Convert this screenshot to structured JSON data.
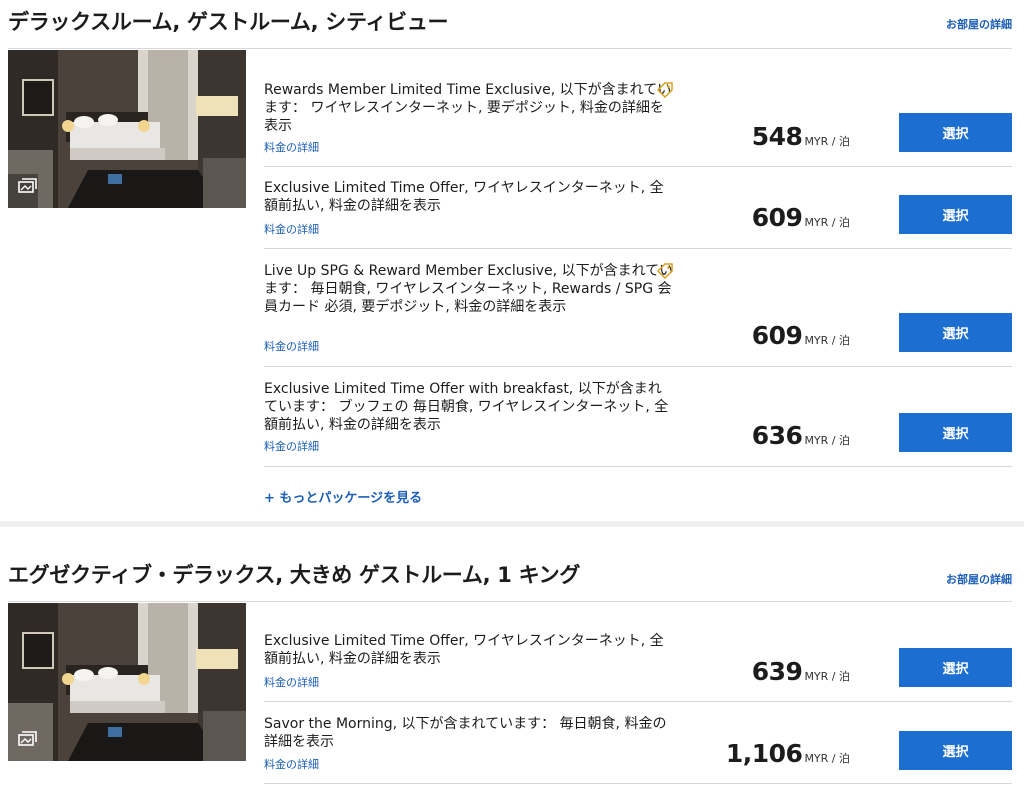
{
  "rooms": [
    {
      "title": "デラックスルーム, ゲストルーム, シティビュー",
      "detail_link": "お部屋の詳細",
      "more_packages": "+ もっとパッケージを見る",
      "rates": [
        {
          "name": "Rewards Member Limited Time Exclusive, 以下が含まれています： ワイヤレスインターネット, 要デポジット, 料金の詳細を表示",
          "detail": "料金の詳細",
          "price": "548",
          "unit": "MYR / 泊",
          "button": "選択",
          "tag": true
        },
        {
          "name": "Exclusive Limited Time Offer, ワイヤレスインターネット, 全額前払い, 料金の詳細を表示",
          "detail": "料金の詳細",
          "price": "609",
          "unit": "MYR / 泊",
          "button": "選択",
          "tag": false
        },
        {
          "name": "Live Up SPG & Reward Member Exclusive, 以下が含まれています： 毎日朝食, ワイヤレスインターネット, Rewards / SPG 会員カード 必須, 要デポジット, 料金の詳細を表示",
          "detail": "料金の詳細",
          "price": "609",
          "unit": "MYR / 泊",
          "button": "選択",
          "tag": true
        },
        {
          "name": "Exclusive Limited Time Offer with breakfast, 以下が含まれています： ブッフェの 毎日朝食, ワイヤレスインターネット, 全額前払い, 料金の詳細を表示",
          "detail": "料金の詳細",
          "price": "636",
          "unit": "MYR / 泊",
          "button": "選択",
          "tag": false
        }
      ]
    },
    {
      "title": "エグゼクティブ・デラックス, 大きめ ゲストルーム, 1 キング",
      "detail_link": "お部屋の詳細",
      "rates": [
        {
          "name": "Exclusive Limited Time Offer, ワイヤレスインターネット, 全額前払い, 料金の詳細を表示",
          "detail": "料金の詳細",
          "price": "639",
          "unit": "MYR / 泊",
          "button": "選択",
          "tag": false
        },
        {
          "name": "Savor the Morning, 以下が含まれています： 毎日朝食, 料金の詳細を表示",
          "detail": "料金の詳細",
          "price": "1,106",
          "unit": "MYR / 泊",
          "button": "選択",
          "tag": false
        }
      ]
    }
  ],
  "colors": {
    "accent": "#1c6fd1",
    "link": "#1c5fb8",
    "tag": "#d6a21e"
  },
  "icons": {
    "gallery": "gallery-icon",
    "tag": "price-tag-icon"
  }
}
